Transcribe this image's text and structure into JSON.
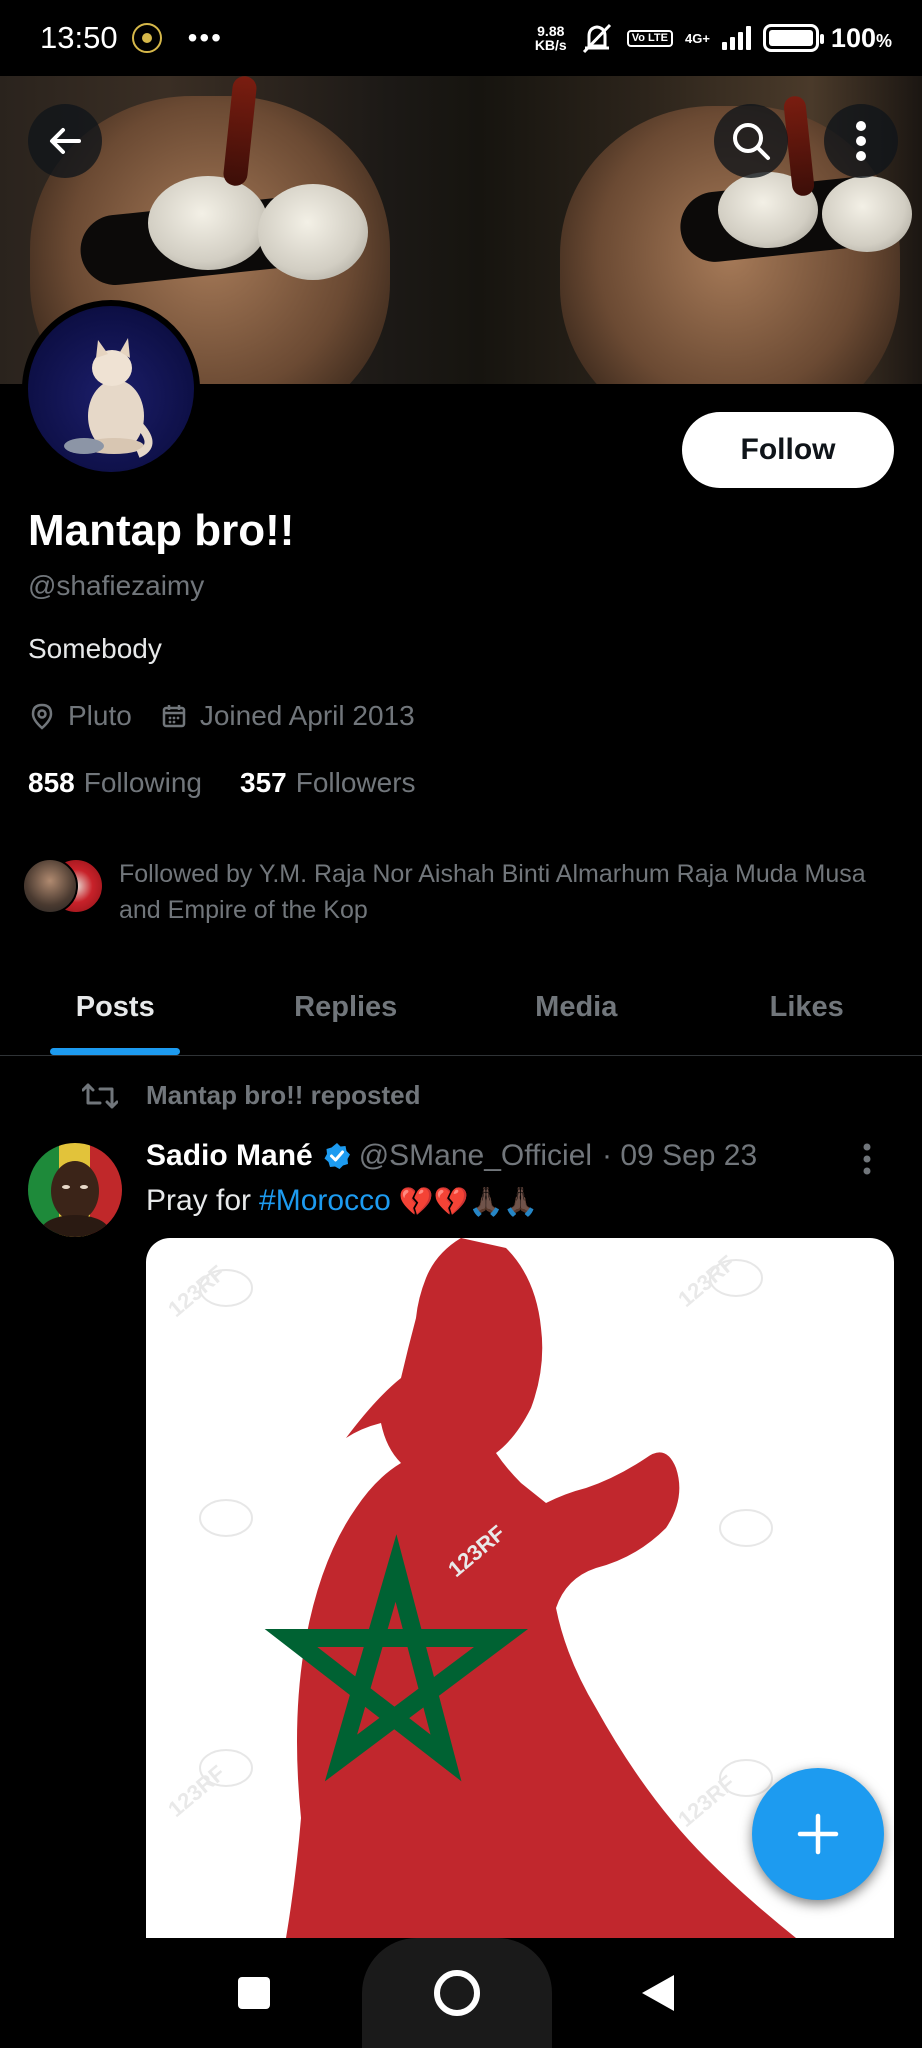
{
  "status_bar": {
    "time": "13:50",
    "dots": "•••",
    "speed_value": "9.88",
    "speed_unit": "KB/s",
    "volte": "Vo LTE",
    "network": "4G+",
    "battery_pct": "100",
    "battery_unit": "%",
    "battery_level": 1.0
  },
  "profile": {
    "display_name": "Mantap bro!!",
    "handle": "@shafiezaimy",
    "bio": "Somebody",
    "location": "Pluto",
    "joined": "Joined April 2013",
    "following_count": "858",
    "following_label": "Following",
    "followers_count": "357",
    "followers_label": "Followers",
    "followed_by": "Followed by Y.M. Raja Nor Aishah Binti Almarhum Raja Muda Musa and Empire of the Kop",
    "follow_label": "Follow"
  },
  "tabs": [
    {
      "label": "Posts",
      "active": true
    },
    {
      "label": "Replies",
      "active": false
    },
    {
      "label": "Media",
      "active": false
    },
    {
      "label": "Likes",
      "active": false
    }
  ],
  "post": {
    "repost_label": "Mantap bro!! reposted",
    "author_name": "Sadio Mané",
    "author_handle": "@SMane_Officiel",
    "date": "· 09 Sep 23",
    "text_prefix": "Pray for",
    "hashtag": "#Morocco",
    "emojis": "💔💔🙏🏿🙏🏿",
    "watermark": "123RF"
  },
  "colors": {
    "accent": "#1d9bf0",
    "background": "#000000",
    "muted_text": "#71767b",
    "morocco_red": "#c1272d",
    "morocco_green": "#006233"
  },
  "icons": {
    "back": "arrow-left-icon",
    "search": "search-icon",
    "more": "more-vertical-icon",
    "location": "location-pin-icon",
    "calendar": "calendar-icon",
    "repost": "repost-icon",
    "verified": "verified-badge-icon",
    "compose": "plus-icon"
  }
}
